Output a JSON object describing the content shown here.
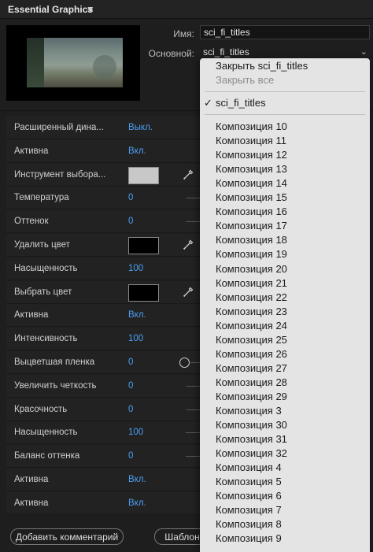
{
  "panel": {
    "title": "Essential Graphics",
    "menu_icon": "≡"
  },
  "fields": {
    "name_label": "Имя:",
    "name_value": "sci_fi_titles",
    "base_label": "Основной:",
    "base_value": "sci_fi_titles"
  },
  "properties": [
    {
      "label": "Расширенный дина...",
      "value": "Выкл.",
      "kind": "text"
    },
    {
      "label": "Активна",
      "value": "Вкл.",
      "kind": "text"
    },
    {
      "label": "Инструмент выбора...",
      "kind": "color",
      "color": "#c8c8c8"
    },
    {
      "label": "Температура",
      "value": "0",
      "kind": "slider"
    },
    {
      "label": "Оттенок",
      "value": "0",
      "kind": "slider"
    },
    {
      "label": "Удалить цвет",
      "kind": "color",
      "color": "#000000"
    },
    {
      "label": "Насыщенность",
      "value": "100",
      "kind": "text"
    },
    {
      "label": "Выбрать цвет",
      "kind": "color",
      "color": "#000000"
    },
    {
      "label": "Активна",
      "value": "Вкл.",
      "kind": "text"
    },
    {
      "label": "Интенсивность",
      "value": "100",
      "kind": "text"
    },
    {
      "label": "Выцветшая пленка",
      "value": "0",
      "kind": "knob"
    },
    {
      "label": "Увеличить четкость",
      "value": "0",
      "kind": "slider"
    },
    {
      "label": "Красочность",
      "value": "0",
      "kind": "slider"
    },
    {
      "label": "Насыщенность",
      "value": "100",
      "kind": "slider"
    },
    {
      "label": "Баланс оттенка",
      "value": "0",
      "kind": "slider"
    },
    {
      "label": "Активна",
      "value": "Вкл.",
      "kind": "text"
    },
    {
      "label": "Активна",
      "value": "Вкл.",
      "kind": "text"
    }
  ],
  "footer": {
    "add_comment": "Добавить комментарий",
    "template": "Шаблон"
  },
  "dropdown": {
    "top_items": [
      {
        "label": "Закрыть sci_fi_titles",
        "disabled": false
      },
      {
        "label": "Закрыть все",
        "disabled": true
      }
    ],
    "current": "sci_fi_titles",
    "check": "✓",
    "compositions": [
      "Композиция 10",
      "Композиция 11",
      "Композиция 12",
      "Композиция 13",
      "Композиция 14",
      "Композиция 15",
      "Композиция 16",
      "Композиция 17",
      "Композиция 18",
      "Композиция 19",
      "Композиция 20",
      "Композиция 21",
      "Композиция 22",
      "Композиция 23",
      "Композиция 24",
      "Композиция 25",
      "Композиция 26",
      "Композиция 27",
      "Композиция 28",
      "Композиция 29",
      "Композиция 3",
      "Композиция 30",
      "Композиция 31",
      "Композиция 32",
      "Композиция 4",
      "Композиция 5",
      "Композиция 6",
      "Композиция 7",
      "Композиция 8",
      "Композиция 9"
    ]
  },
  "colors": {
    "accent": "#4c9ef3",
    "panel_bg": "#1e1e1e",
    "menu_bg": "#e4e4e4"
  }
}
